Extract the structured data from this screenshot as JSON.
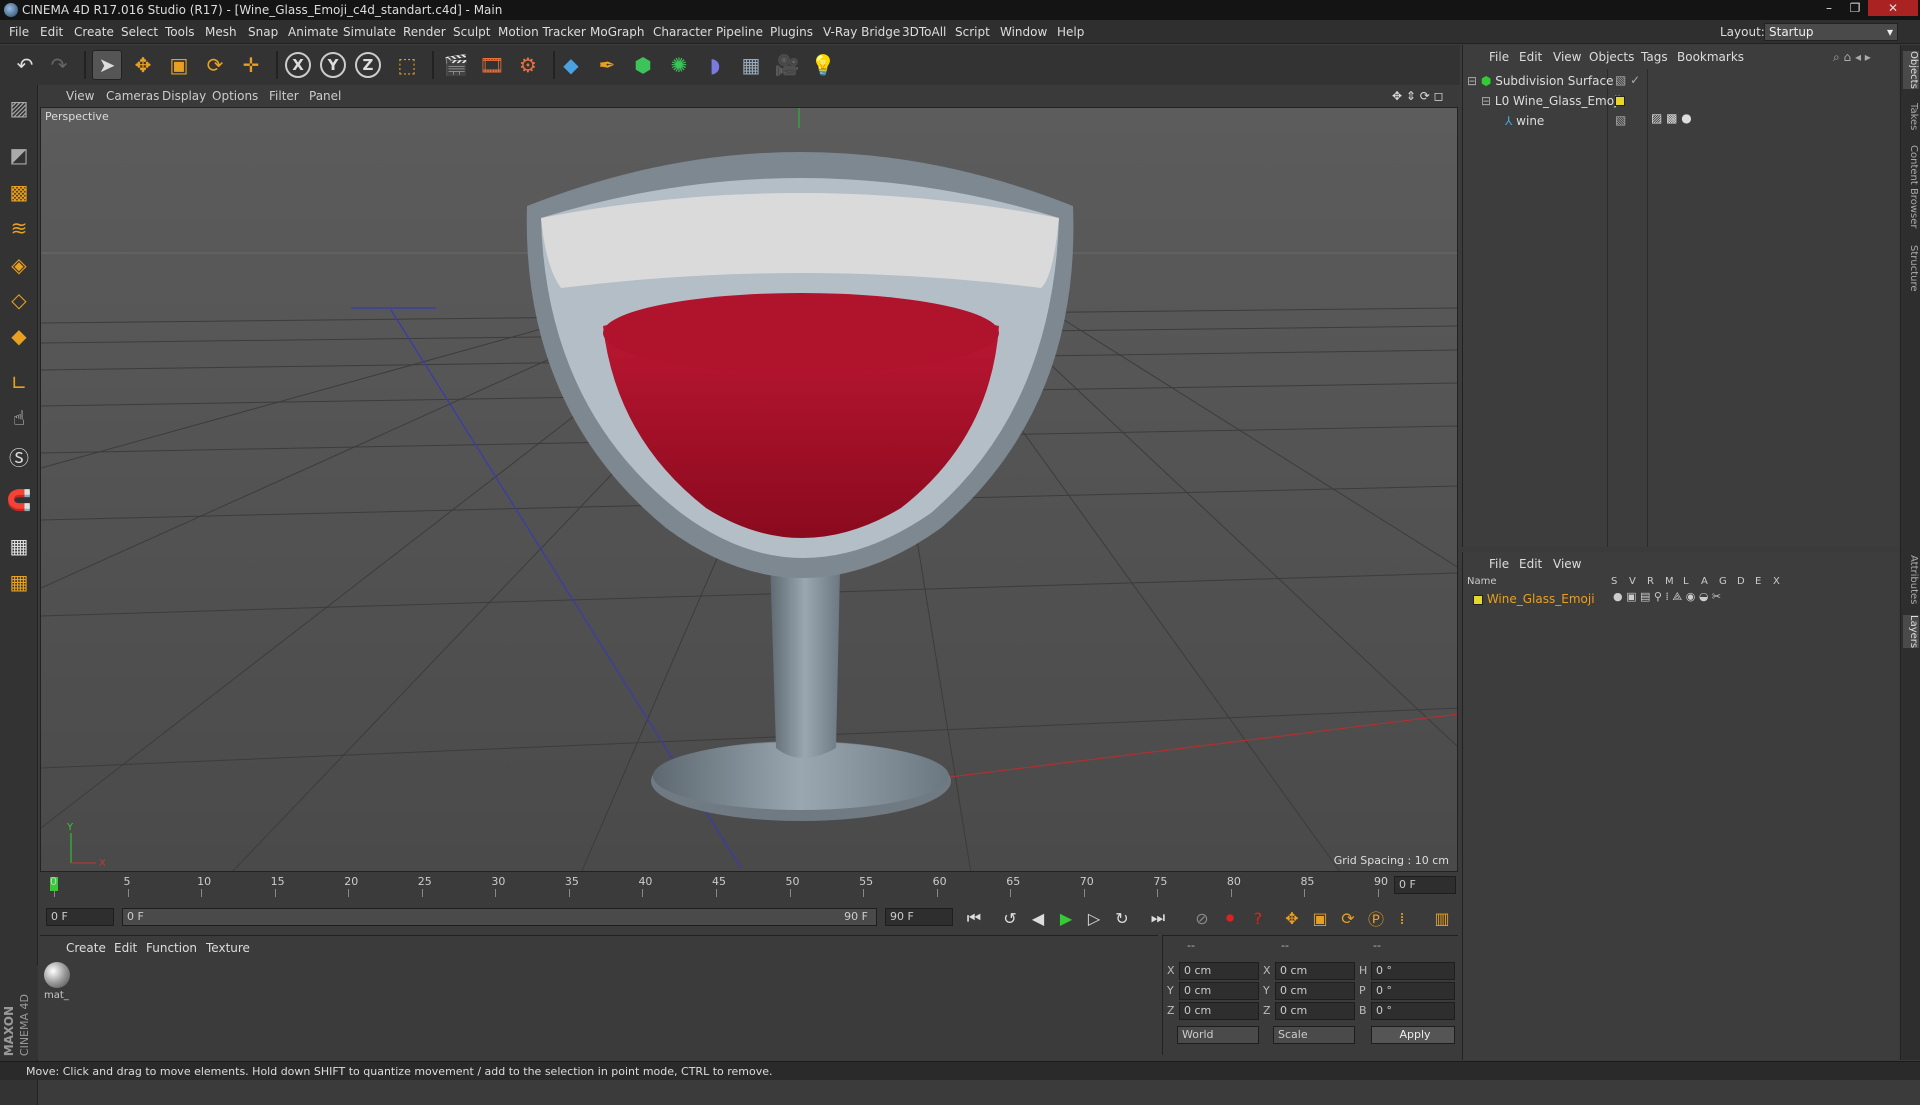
{
  "window": {
    "title": "CINEMA 4D R17.016 Studio (R17) - [Wine_Glass_Emoji_c4d_standart.c4d] - Main",
    "controls": [
      "–",
      "❐",
      "✕"
    ]
  },
  "menubar": {
    "items": [
      "File",
      "Edit",
      "Create",
      "Select",
      "Tools",
      "Mesh",
      "Snap",
      "Animate",
      "Simulate",
      "Render",
      "Sculpt",
      "Motion Tracker",
      "MoGraph",
      "Character",
      "Pipeline",
      "Plugins",
      "V-Ray Bridge",
      "3DToAll",
      "Script",
      "Window",
      "Help"
    ],
    "layout_label": "Layout:",
    "layout_value": "Startup"
  },
  "toolbar": {
    "icons": [
      "undo-icon",
      "redo-icon",
      "select-arrow-icon",
      "move-icon",
      "scale-icon",
      "rotate-icon",
      "live-select-icon",
      "x-axis-icon",
      "y-axis-icon",
      "z-axis-icon",
      "coordinate-system-icon",
      "render-view-icon",
      "render-picture-viewer-icon",
      "render-settings-icon",
      "cube-primitive-icon",
      "pen-spline-icon",
      "subdivision-nurbs-icon",
      "array-icon",
      "deformer-icon",
      "floor-icon",
      "camera-icon",
      "light-icon"
    ],
    "axis_labels": [
      "X",
      "Y",
      "Z"
    ]
  },
  "viewport": {
    "menu": [
      "View",
      "Cameras",
      "Display",
      "Options",
      "Filter",
      "Panel"
    ],
    "camera_label": "Perspective",
    "grid_spacing": "Grid Spacing : 10 cm",
    "axis_y": "Y",
    "axis_x": "X",
    "colors": {
      "wine": "#b0102a",
      "glass": "#8a969f"
    }
  },
  "timeline": {
    "ticks": [
      "0",
      "5",
      "10",
      "15",
      "20",
      "25",
      "30",
      "35",
      "40",
      "45",
      "50",
      "55",
      "60",
      "65",
      "70",
      "75",
      "80",
      "85",
      "90"
    ],
    "current_frame_field": "0 F"
  },
  "animation": {
    "start_field": "0 F",
    "range_start": "0 F",
    "range_end": "90 F",
    "end_field": "90 F"
  },
  "material_panel": {
    "menu": [
      "Create",
      "Edit",
      "Function",
      "Texture"
    ],
    "material_name": "mat_",
    "brand_maxon": "MAXON",
    "brand_c4d": "CINEMA 4D"
  },
  "coords": {
    "headers": [
      "--",
      "--",
      "--"
    ],
    "pos": {
      "x": "0 cm",
      "y": "0 cm",
      "z": "0 cm"
    },
    "size": {
      "x": "0 cm",
      "y": "0 cm",
      "z": "0 cm"
    },
    "rot": {
      "h": "0 °",
      "p": "0 °",
      "b": "0 °"
    },
    "labels": {
      "x": "X",
      "y": "Y",
      "z": "Z",
      "h": "H",
      "p": "P",
      "b": "B"
    },
    "world": "World",
    "scale": "Scale",
    "apply": "Apply"
  },
  "object_manager": {
    "menu": [
      "File",
      "Edit",
      "View",
      "Objects",
      "Tags",
      "Bookmarks"
    ],
    "objects": [
      {
        "name": "Subdivision Surface",
        "indent": 0
      },
      {
        "name": "Wine_Glass_Emoji",
        "indent": 1
      },
      {
        "name": "wine",
        "indent": 2
      }
    ]
  },
  "layer_manager": {
    "menu": [
      "File",
      "Edit",
      "View"
    ],
    "columns": [
      "Name",
      "S",
      "V",
      "R",
      "M",
      "L",
      "A",
      "G",
      "D",
      "E",
      "X"
    ],
    "layers": [
      {
        "name": "Wine_Glass_Emoji",
        "color": "#e5d72c"
      }
    ]
  },
  "side_tabs": [
    "Objects",
    "Takes",
    "Content Browser",
    "Structure",
    "Attributes",
    "Layers"
  ],
  "status": "Move: Click and drag to move elements. Hold down SHIFT to quantize movement / add to the selection in point mode, CTRL to remove."
}
